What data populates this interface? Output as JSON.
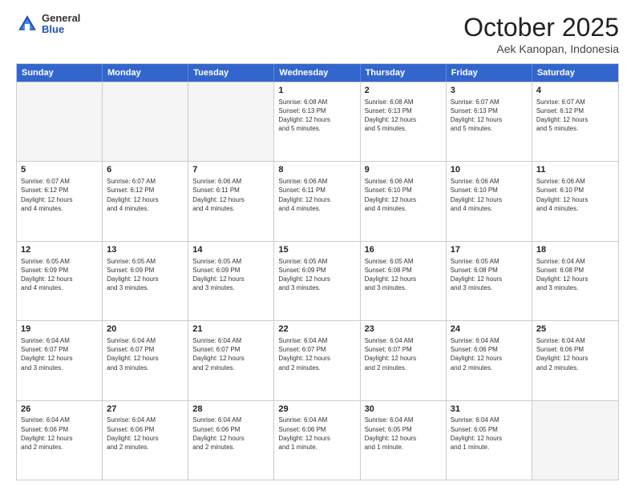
{
  "header": {
    "logo": {
      "general": "General",
      "blue": "Blue"
    },
    "title": "October 2025",
    "location": "Aek Kanopan, Indonesia"
  },
  "weekdays": [
    "Sunday",
    "Monday",
    "Tuesday",
    "Wednesday",
    "Thursday",
    "Friday",
    "Saturday"
  ],
  "rows": [
    [
      {
        "day": "",
        "info": ""
      },
      {
        "day": "",
        "info": ""
      },
      {
        "day": "",
        "info": ""
      },
      {
        "day": "1",
        "info": "Sunrise: 6:08 AM\nSunset: 6:13 PM\nDaylight: 12 hours\nand 5 minutes."
      },
      {
        "day": "2",
        "info": "Sunrise: 6:08 AM\nSunset: 6:13 PM\nDaylight: 12 hours\nand 5 minutes."
      },
      {
        "day": "3",
        "info": "Sunrise: 6:07 AM\nSunset: 6:13 PM\nDaylight: 12 hours\nand 5 minutes."
      },
      {
        "day": "4",
        "info": "Sunrise: 6:07 AM\nSunset: 6:12 PM\nDaylight: 12 hours\nand 5 minutes."
      }
    ],
    [
      {
        "day": "5",
        "info": "Sunrise: 6:07 AM\nSunset: 6:12 PM\nDaylight: 12 hours\nand 4 minutes."
      },
      {
        "day": "6",
        "info": "Sunrise: 6:07 AM\nSunset: 6:12 PM\nDaylight: 12 hours\nand 4 minutes."
      },
      {
        "day": "7",
        "info": "Sunrise: 6:06 AM\nSunset: 6:11 PM\nDaylight: 12 hours\nand 4 minutes."
      },
      {
        "day": "8",
        "info": "Sunrise: 6:06 AM\nSunset: 6:11 PM\nDaylight: 12 hours\nand 4 minutes."
      },
      {
        "day": "9",
        "info": "Sunrise: 6:06 AM\nSunset: 6:10 PM\nDaylight: 12 hours\nand 4 minutes."
      },
      {
        "day": "10",
        "info": "Sunrise: 6:06 AM\nSunset: 6:10 PM\nDaylight: 12 hours\nand 4 minutes."
      },
      {
        "day": "11",
        "info": "Sunrise: 6:06 AM\nSunset: 6:10 PM\nDaylight: 12 hours\nand 4 minutes."
      }
    ],
    [
      {
        "day": "12",
        "info": "Sunrise: 6:05 AM\nSunset: 6:09 PM\nDaylight: 12 hours\nand 4 minutes."
      },
      {
        "day": "13",
        "info": "Sunrise: 6:05 AM\nSunset: 6:09 PM\nDaylight: 12 hours\nand 3 minutes."
      },
      {
        "day": "14",
        "info": "Sunrise: 6:05 AM\nSunset: 6:09 PM\nDaylight: 12 hours\nand 3 minutes."
      },
      {
        "day": "15",
        "info": "Sunrise: 6:05 AM\nSunset: 6:09 PM\nDaylight: 12 hours\nand 3 minutes."
      },
      {
        "day": "16",
        "info": "Sunrise: 6:05 AM\nSunset: 6:08 PM\nDaylight: 12 hours\nand 3 minutes."
      },
      {
        "day": "17",
        "info": "Sunrise: 6:05 AM\nSunset: 6:08 PM\nDaylight: 12 hours\nand 3 minutes."
      },
      {
        "day": "18",
        "info": "Sunrise: 6:04 AM\nSunset: 6:08 PM\nDaylight: 12 hours\nand 3 minutes."
      }
    ],
    [
      {
        "day": "19",
        "info": "Sunrise: 6:04 AM\nSunset: 6:07 PM\nDaylight: 12 hours\nand 3 minutes."
      },
      {
        "day": "20",
        "info": "Sunrise: 6:04 AM\nSunset: 6:07 PM\nDaylight: 12 hours\nand 3 minutes."
      },
      {
        "day": "21",
        "info": "Sunrise: 6:04 AM\nSunset: 6:07 PM\nDaylight: 12 hours\nand 2 minutes."
      },
      {
        "day": "22",
        "info": "Sunrise: 6:04 AM\nSunset: 6:07 PM\nDaylight: 12 hours\nand 2 minutes."
      },
      {
        "day": "23",
        "info": "Sunrise: 6:04 AM\nSunset: 6:07 PM\nDaylight: 12 hours\nand 2 minutes."
      },
      {
        "day": "24",
        "info": "Sunrise: 6:04 AM\nSunset: 6:06 PM\nDaylight: 12 hours\nand 2 minutes."
      },
      {
        "day": "25",
        "info": "Sunrise: 6:04 AM\nSunset: 6:06 PM\nDaylight: 12 hours\nand 2 minutes."
      }
    ],
    [
      {
        "day": "26",
        "info": "Sunrise: 6:04 AM\nSunset: 6:06 PM\nDaylight: 12 hours\nand 2 minutes."
      },
      {
        "day": "27",
        "info": "Sunrise: 6:04 AM\nSunset: 6:06 PM\nDaylight: 12 hours\nand 2 minutes."
      },
      {
        "day": "28",
        "info": "Sunrise: 6:04 AM\nSunset: 6:06 PM\nDaylight: 12 hours\nand 2 minutes."
      },
      {
        "day": "29",
        "info": "Sunrise: 6:04 AM\nSunset: 6:06 PM\nDaylight: 12 hours\nand 1 minute."
      },
      {
        "day": "30",
        "info": "Sunrise: 6:04 AM\nSunset: 6:05 PM\nDaylight: 12 hours\nand 1 minute."
      },
      {
        "day": "31",
        "info": "Sunrise: 6:04 AM\nSunset: 6:05 PM\nDaylight: 12 hours\nand 1 minute."
      },
      {
        "day": "",
        "info": ""
      }
    ]
  ]
}
